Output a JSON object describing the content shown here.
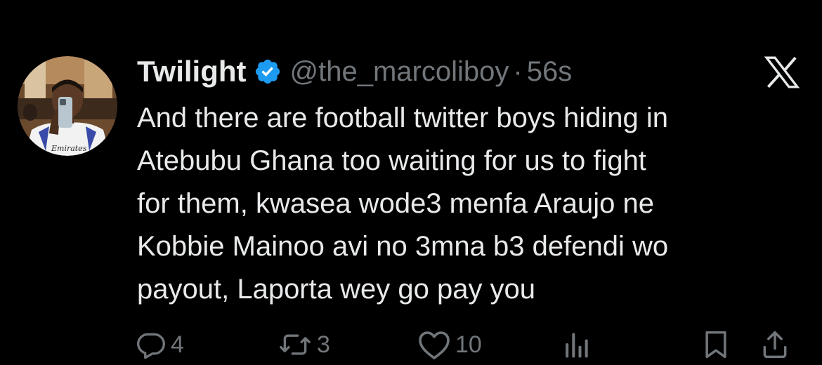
{
  "tweet": {
    "display_name": "Twilight",
    "handle": "@the_marcoliboy",
    "separator": "·",
    "time": "56s",
    "text": "And there are football twitter boys hiding in\nAtebubu Ghana too waiting for us to fight\nfor them, kwasea wode3 menfa Araujo ne\nKobbie Mainoo avi no 3mna b3 defendi wo\npayout, Laporta wey go pay you",
    "avatar_jersey_text": "Emirates"
  },
  "actions": {
    "replies": "4",
    "reposts": "3",
    "likes": "10"
  },
  "icons": {
    "verified": "verified-badge-icon",
    "brand": "x-logo-icon",
    "reply": "reply-icon",
    "repost": "repost-icon",
    "like": "heart-icon",
    "views": "analytics-icon",
    "bookmark": "bookmark-icon",
    "share": "share-icon"
  },
  "colors": {
    "background": "#000000",
    "text_primary": "#e7e9ea",
    "text_secondary": "#71767b",
    "verified_blue": "#1d9bf0"
  }
}
